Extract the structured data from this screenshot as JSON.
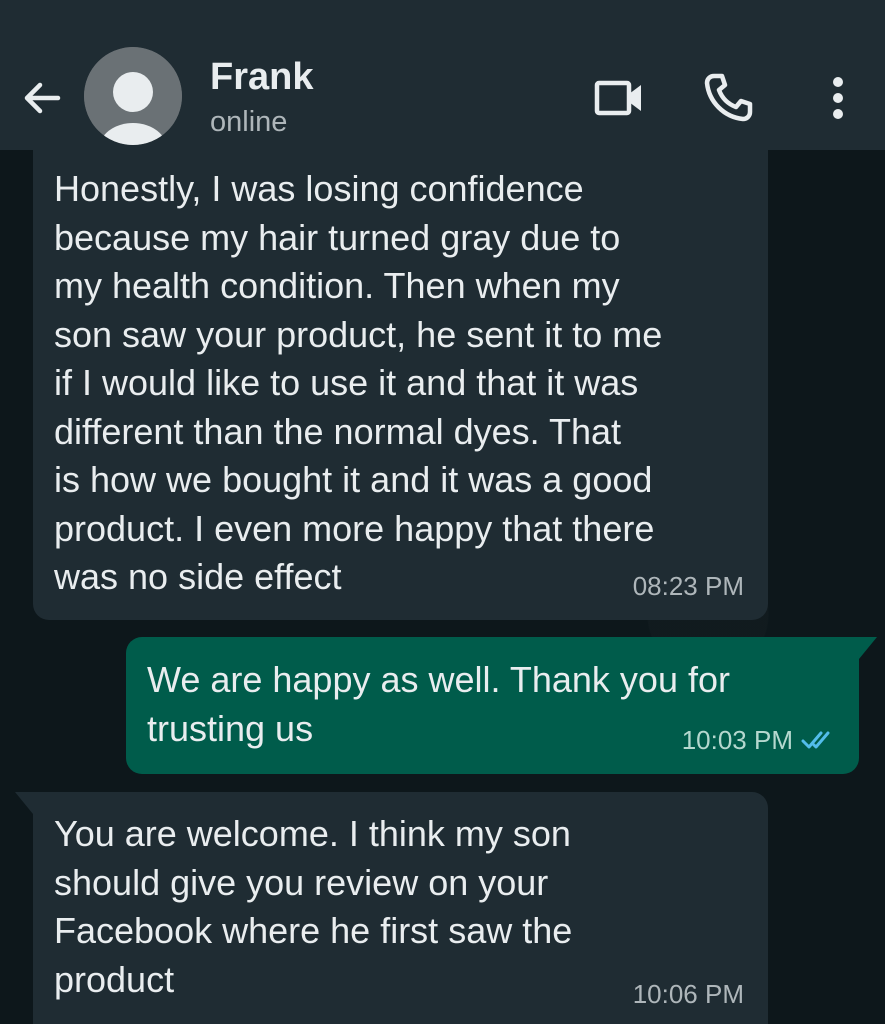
{
  "header": {
    "contact_name": "Frank",
    "status": "online"
  },
  "icons": {
    "back": "arrow-left-icon",
    "avatar": "default-avatar-icon",
    "video": "video-camera-icon",
    "call": "phone-icon",
    "menu": "more-vertical-icon",
    "read_receipt": "double-check-icon"
  },
  "colors": {
    "header_bg": "#1f2c33",
    "incoming_bubble": "#1f2c33",
    "outgoing_bubble": "#005c4b",
    "read_tick": "#53bdeb"
  },
  "messages": [
    {
      "direction": "incoming",
      "text": "Honestly, I was losing confidence\nbecause my hair turned gray due to\nmy health condition. Then when my\nson saw your product, he sent it to me\nif I would like to use it and that it was\ndifferent than the normal dyes. That\nis how we bought it and it was a good\nproduct. I even more happy that there\nwas no side effect",
      "time": "08:23 PM"
    },
    {
      "direction": "outgoing",
      "text": "We are happy as well. Thank you for\ntrusting us",
      "time": "10:03 PM",
      "status": "read"
    },
    {
      "direction": "incoming",
      "text": "You are welcome. I think my son\nshould give you review on your\nFacebook where he first saw the\nproduct",
      "time": "10:06 PM"
    }
  ]
}
